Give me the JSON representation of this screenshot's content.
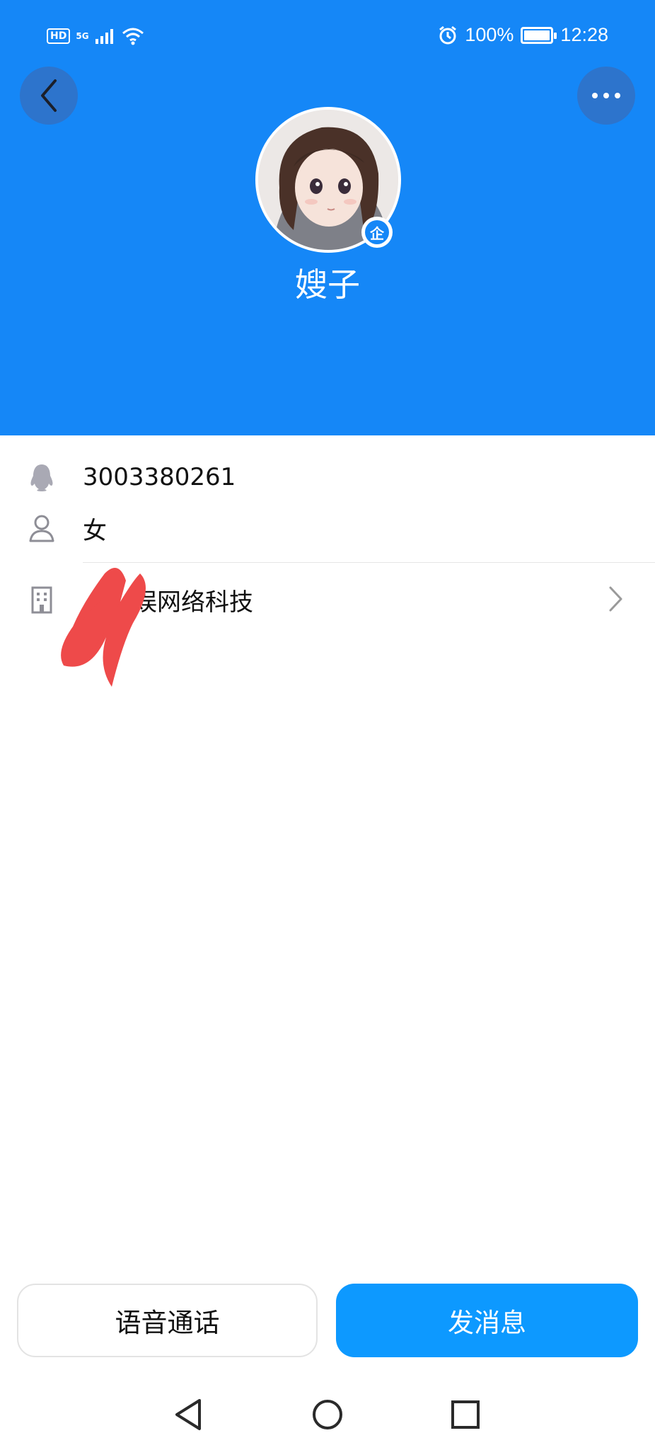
{
  "status_bar": {
    "network_hd": "HD",
    "network_gen": "5G",
    "battery": "100%",
    "battery_level": 1.0,
    "time": "12:28"
  },
  "header": {
    "background_color": "#1587f7",
    "back_icon": "back-arrow-icon",
    "more_icon": "more-dots-icon",
    "nickname": "嫂子",
    "badge": "企"
  },
  "profile": {
    "qq_number": "3003380261",
    "gender": "女",
    "company": "娱网络科技",
    "company_icon": "building-icon",
    "company_chevron": "chevron-right-icon"
  },
  "actions": {
    "voice_call": "语音通话",
    "send_message": "发消息",
    "accent_color": "#0d99ff"
  },
  "nav_bar": {
    "back": "nav-back-icon",
    "home": "nav-home-icon",
    "recents": "nav-recents-icon"
  }
}
